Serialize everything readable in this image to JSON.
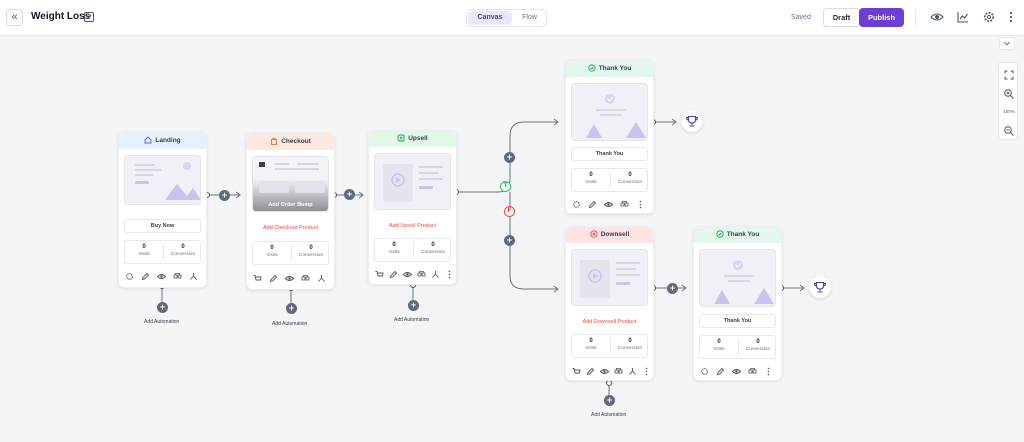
{
  "header": {
    "title": "Weight Loss",
    "tabs": {
      "canvas": "Canvas",
      "flow": "Flow"
    },
    "status": "Saved",
    "draft_label": "Draft",
    "publish_label": "Publish"
  },
  "zoom": "100%",
  "colors": {
    "accent": "#6c3ed8",
    "danger": "#ef4444",
    "success": "#22c55e"
  },
  "nodes": {
    "landing": {
      "title": "Landing",
      "button": "Buy Now",
      "visits": "0",
      "visits_label": "Visits",
      "conversion": "0",
      "conversion_label": "Conversion",
      "automation": "Add Automation"
    },
    "checkout": {
      "title": "Checkout",
      "bump": "Add Order Bump",
      "add_link": "Add Checkout Product",
      "visits": "0",
      "visits_label": "Visits",
      "conversion": "0",
      "conversion_label": "Conversion",
      "automation": "Add Automation"
    },
    "upsell": {
      "title": "Upsell",
      "add_link": "Add Upsell Product",
      "visits": "0",
      "visits_label": "Visits",
      "conversion": "0",
      "conversion_label": "Conversion",
      "automation": "Add Automation"
    },
    "thankyou1": {
      "title": "Thank You",
      "button": "Thank You",
      "visits": "0",
      "visits_label": "Visits",
      "conversion": "0",
      "conversion_label": "Conversion"
    },
    "downsell": {
      "title": "Downsell",
      "add_link": "Add Downsell Product",
      "visits": "0",
      "visits_label": "Visits",
      "conversion": "0",
      "conversion_label": "Conversion",
      "automation": "Add Automation"
    },
    "thankyou2": {
      "title": "Thank You",
      "button": "Thank You",
      "visits": "0",
      "visits_label": "Visits",
      "conversion": "0",
      "conversion_label": "Conversion"
    }
  },
  "branches": {
    "true": "T",
    "false": "F"
  }
}
